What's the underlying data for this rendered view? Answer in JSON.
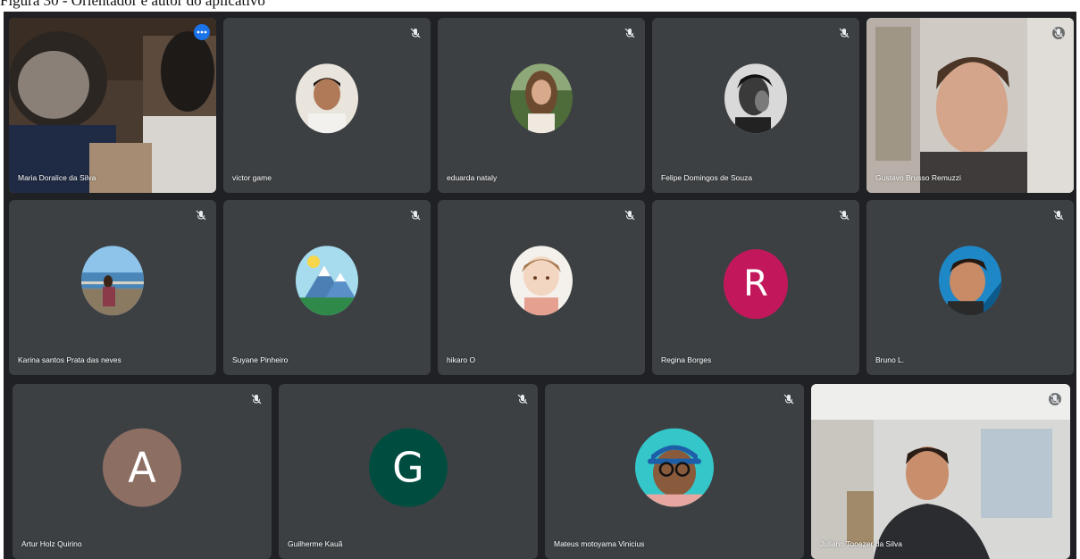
{
  "caption": "Figura 30 - Orientador e autor do aplicativo",
  "participants": [
    {
      "name": "Maria Doralice da Silva",
      "state": "video",
      "active": true
    },
    {
      "name": "victor game",
      "state": "photo",
      "muted": true
    },
    {
      "name": "eduarda nataly",
      "state": "photo",
      "muted": true
    },
    {
      "name": "Felipe Domingos de Souza",
      "state": "photo",
      "muted": true
    },
    {
      "name": "Gustavo Brusso Remuzzi",
      "state": "video",
      "muted": true
    },
    {
      "name": "Karina santos Prata das neves",
      "state": "photo",
      "muted": true
    },
    {
      "name": "Suyane Pinheiro",
      "state": "photo",
      "muted": true
    },
    {
      "name": "hikaro O",
      "state": "photo",
      "muted": true
    },
    {
      "name": "Regina Borges",
      "state": "initial",
      "initial": "R",
      "color": "#c2185b",
      "muted": true
    },
    {
      "name": "Bruno L.",
      "state": "photo",
      "muted": true
    },
    {
      "name": "Artur Holz Quirino",
      "state": "initial",
      "initial": "A",
      "color": "#8d6e63",
      "muted": true
    },
    {
      "name": "Guilherme Kauã",
      "state": "initial",
      "initial": "G",
      "color": "#004d40",
      "muted": true
    },
    {
      "name": "Mateus motoyama Vinicius",
      "state": "photo",
      "muted": true
    },
    {
      "name": "Juliano Tonezer da Silva",
      "state": "video",
      "muted": true
    }
  ],
  "icons": {
    "mic": "mic-off-icon",
    "more": "more-options-icon"
  },
  "colors": {
    "background": "#202124",
    "tile": "#3c4043",
    "active_border": "#8ab4f8",
    "accent": "#1a73e8"
  }
}
